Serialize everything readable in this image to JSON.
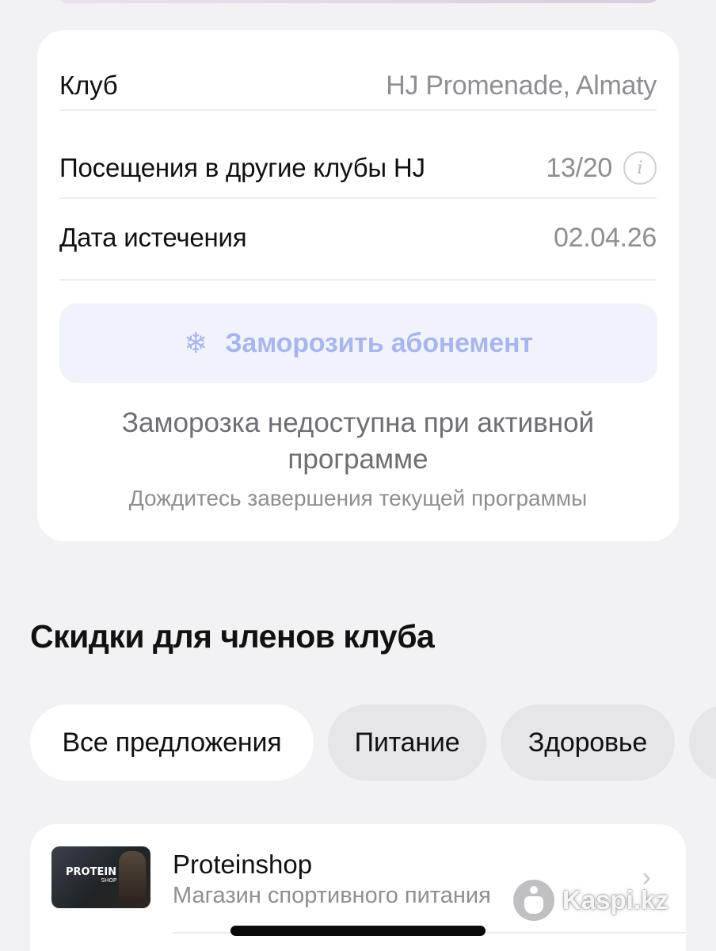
{
  "membership": {
    "club_label": "Клуб",
    "club_value": "HJ Promenade, Almaty",
    "visits_label": "Посещения в другие клубы HJ",
    "visits_value": "13/20",
    "info_icon": "info-circle-icon",
    "expiry_label": "Дата истечения",
    "expiry_value": "02.04.26",
    "freeze_icon": "snowflake-icon",
    "freeze_button_label": "Заморозить абонемент",
    "freeze_note": "Заморозка недоступна при активной программе",
    "freeze_subnote": "Дождитесь завершения текущей программы"
  },
  "discounts": {
    "title": "Скидки для членов клуба",
    "filters": [
      {
        "label": "Все предложения",
        "selected": true
      },
      {
        "label": "Питание",
        "selected": false
      },
      {
        "label": "Здоровье",
        "selected": false
      }
    ],
    "offers": [
      {
        "name": "Proteinshop",
        "description": "Магазин спортивного питания",
        "logo_text": "PROTEIN",
        "logo_subtext": "SHOP"
      }
    ]
  },
  "watermark": {
    "text": "Kaspi.kz"
  },
  "colors": {
    "background": "#f2f2f4",
    "card": "#ffffff",
    "chip_inactive": "#e6e6ea",
    "accent_disabled": "#a9b6ec",
    "secondary_text": "#8e8e93"
  }
}
